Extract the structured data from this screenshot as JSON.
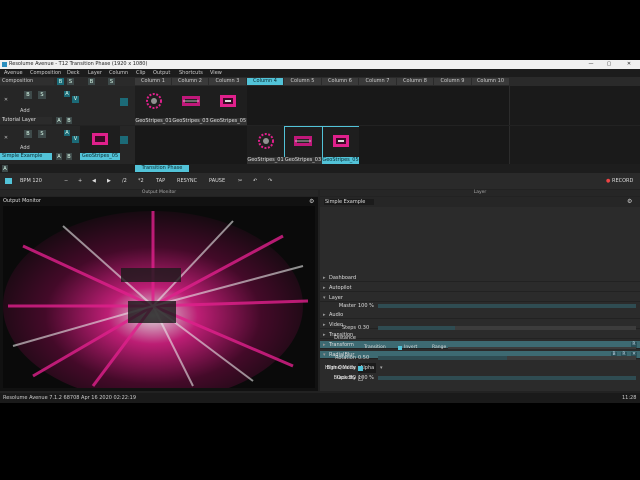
{
  "window": {
    "title": "Resolume Avenue - T12 Transition Phase (1920 x 1080)",
    "controls": [
      "—",
      "▢",
      "✕"
    ]
  },
  "menu": [
    "Avenue",
    "Composition",
    "Deck",
    "Layer",
    "Column",
    "Clip",
    "Output",
    "Shortcuts",
    "View"
  ],
  "composition_label": "Composition",
  "columns": [
    "Column 1",
    "Column 2",
    "Column 3",
    "Column 4",
    "Column 5",
    "Column 6",
    "Column 7",
    "Column 8",
    "Column 9",
    "Column 10"
  ],
  "selected_column_index": 3,
  "layer1": {
    "name": "Tutorial Layer",
    "clips": [
      "GeoStripes_01",
      "GeoStripes_03",
      "GeoStripes_05"
    ],
    "add_label": "Add",
    "btn_b": "B",
    "btn_s": "S",
    "btn_a": "A",
    "btn_v": "V"
  },
  "layer2": {
    "name": "Simple Example",
    "left_clip": "GeoStripes_05",
    "clips": [
      "GeoStripes_01",
      "GeoStripes_03",
      "GeoStripes_05"
    ],
    "add_label": "Add"
  },
  "deck_tab": "Transition Phase",
  "toolbar": {
    "bpm": "BPM 120",
    "minus": "−",
    "plus": "+",
    "prev": "◀",
    "next": "▶",
    "div": "/2",
    "mult": "*2",
    "tap": "TAP",
    "resync": "RESYNC",
    "pause": "PAUSE",
    "record": "RECORD"
  },
  "section_headers": {
    "output": "Output Monitor",
    "layer": "Layer"
  },
  "monitor_label": "Output Monitor",
  "layer_panel": {
    "name_field": "Simple Example",
    "rows": [
      "Dashboard",
      "Autopilot",
      "Layer",
      "Audio",
      "Video",
      "Transition",
      "Transform",
      "RadialBlur"
    ],
    "master_label": "Master",
    "master_value": "100 %",
    "params": [
      {
        "name": "Blend Mode",
        "value": "Alpha",
        "level": null
      },
      {
        "name": "Opacity",
        "value": "100 %",
        "level": 1.0
      },
      {
        "name": "Steps",
        "value": "0.30",
        "level": 0.3
      },
      {
        "name": "Distance",
        "value": "",
        "level": null
      },
      {
        "name": "Rotation",
        "value": "0.50",
        "level": 0.5
      },
      {
        "name": "High Quality",
        "value": "",
        "level": null
      },
      {
        "name": "Black BG",
        "value": "",
        "level": null
      }
    ],
    "transition_label": "Transition",
    "invert_label": "Invert",
    "range_label": "Range"
  },
  "status": {
    "left": "Resolume Avenue 7.1.2 68708 Apr 16 2020 02:22:19",
    "right": "11:28"
  },
  "colors": {
    "accent": "#52c3d8",
    "magenta": "#e0208c"
  }
}
